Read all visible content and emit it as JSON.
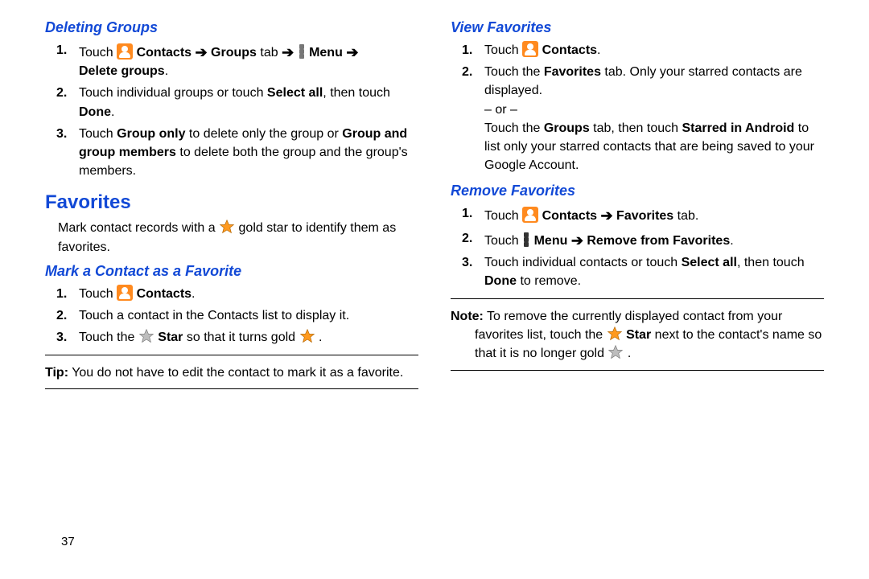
{
  "left": {
    "deleting_groups": {
      "title": "Deleting Groups",
      "steps": [
        {
          "n": "1.",
          "pre": "Touch ",
          "bold1": "Contacts",
          "arrow1": true,
          "bold2": "Groups",
          "tab": " tab ",
          "arrow2": true,
          "menu_icon": true,
          "bold3": "Menu",
          "arrow3": true,
          "line2_bold": "Delete groups",
          "line2_post": "."
        },
        {
          "n": "2.",
          "text_a": "Touch individual groups or touch ",
          "bold_a": "Select all",
          "text_b": ", then touch ",
          "bold_b": "Done",
          "text_c": "."
        },
        {
          "n": "3.",
          "text_a": "Touch ",
          "bold_a": "Group only",
          "text_b": " to delete only the group or ",
          "bold_b": "Group and group members",
          "text_c": " to delete both the group and the group's members."
        }
      ]
    },
    "favorites": {
      "title": "Favorites",
      "intro_a": "Mark contact records with a ",
      "intro_b": " gold star to identify them as favorites."
    },
    "mark_fav": {
      "title": "Mark a Contact as a Favorite",
      "steps": {
        "s1": {
          "n": "1.",
          "pre": "Touch ",
          "bold": "Contacts",
          "post": "."
        },
        "s2": {
          "n": "2.",
          "text": "Touch a contact in the Contacts list to display it."
        },
        "s3": {
          "n": "3.",
          "pre": "Touch the ",
          "bold": "Star",
          "mid": " so that it turns gold ",
          "post": "."
        }
      },
      "tip_label": "Tip:",
      "tip_text": " You do not have to edit the contact to mark it as a favorite."
    }
  },
  "right": {
    "view_fav": {
      "title": "View Favorites",
      "s1": {
        "n": "1.",
        "pre": "Touch ",
        "bold": "Contacts",
        "post": "."
      },
      "s2": {
        "n": "2.",
        "pre": "Touch the ",
        "bold": "Favorites",
        "post": " tab. Only your starred contacts are displayed.",
        "or": "– or –",
        "line3a": "Touch the ",
        "bold2": "Groups",
        "mid2": " tab, then touch ",
        "bold3": "Starred in Android",
        "tail": " to list only your starred contacts that are being saved to your Google Account."
      }
    },
    "remove_fav": {
      "title": "Remove Favorites",
      "s1": {
        "n": "1.",
        "pre": "Touch ",
        "bold": "Contacts",
        "arrow": true,
        "bold2": "Favorites",
        "post": " tab."
      },
      "s2": {
        "n": "2.",
        "pre": "Touch ",
        "bold": "Menu",
        "arrow": true,
        "bold2": "Remove from Favorites",
        "post": "."
      },
      "s3": {
        "n": "3.",
        "pre": "Touch individual contacts or touch ",
        "bold": "Select all",
        "mid": ", then touch ",
        "bold2": "Done",
        "post": " to remove."
      },
      "note_label": "Note:",
      "note_a": " To remove the currently displayed contact from your favorites list, touch the ",
      "note_bold": "Star",
      "note_b": " next to the contact's name so that it is no longer gold ",
      "note_c": "."
    }
  },
  "page_number": "37"
}
